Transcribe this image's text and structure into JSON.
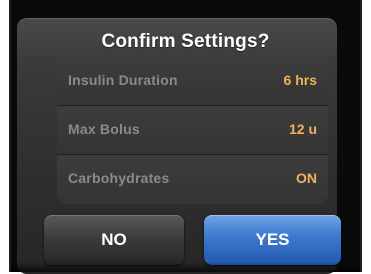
{
  "dialog": {
    "title": "Confirm Settings?"
  },
  "settings": [
    {
      "label": "Insulin Duration",
      "value": "6 hrs"
    },
    {
      "label": "Max Bolus",
      "value": "12 u"
    },
    {
      "label": "Carbohydrates",
      "value": "ON"
    }
  ],
  "buttons": {
    "no_label": "NO",
    "yes_label": "YES"
  },
  "colors": {
    "value_accent": "#f0b15a",
    "label_text": "#8a8a8a",
    "yes_button": "#3f7bd0",
    "no_button": "#3c3c3c",
    "screen_background": "#0a0a0a"
  }
}
